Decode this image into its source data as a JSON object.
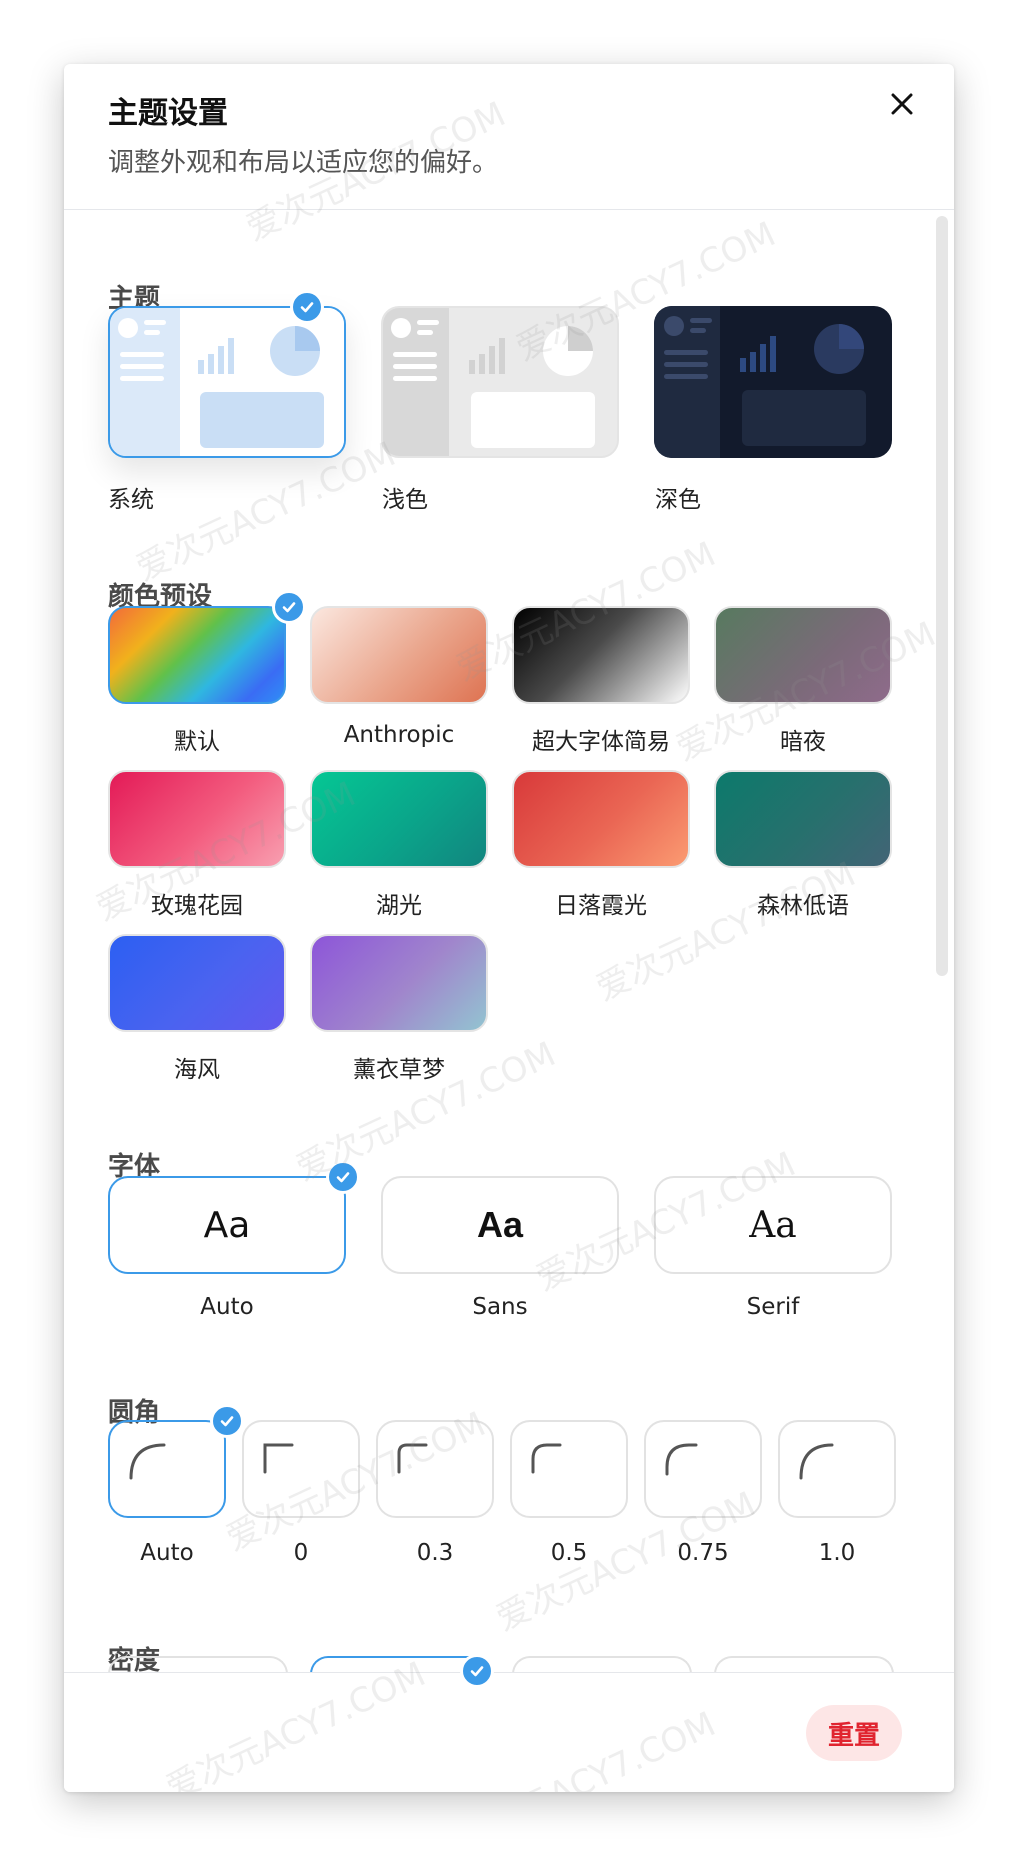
{
  "header": {
    "title": "主题设置",
    "subtitle": "调整外观和布局以适应您的偏好。",
    "close_icon": "close-icon"
  },
  "sections": {
    "theme": "主题",
    "color_presets": "颜色预设",
    "font": "字体",
    "radius": "圆角",
    "density": "密度"
  },
  "themes": [
    {
      "label": "系统",
      "selected": true
    },
    {
      "label": "浅色",
      "selected": false
    },
    {
      "label": "深色",
      "selected": false
    }
  ],
  "presets": [
    {
      "label": "默认",
      "selected": true,
      "gradient": "linear-gradient(135deg,#f26b3a 0%,#f1b11c 25%,#61c14a 45%,#2fb7e0 65%,#3a6cf4 85%,#2f8ef6 100%)"
    },
    {
      "label": "Anthropic",
      "selected": false,
      "gradient": "linear-gradient(135deg,#fbe7df 0%,#eaa68d 55%,#de7352 100%)"
    },
    {
      "label": "超大字体简易",
      "selected": false,
      "gradient": "linear-gradient(135deg,#000000 0%,#4a4a4a 45%,#ffffff 100%)"
    },
    {
      "label": "暗夜",
      "selected": false,
      "gradient": "linear-gradient(135deg,#577a5f 0%,#7b6a79 60%,#8f6b8b 100%)"
    },
    {
      "label": "玫瑰花园",
      "selected": false,
      "gradient": "linear-gradient(135deg,#e31a57 0%,#f35b7e 55%,#f89fb0 100%)"
    },
    {
      "label": "湖光",
      "selected": false,
      "gradient": "linear-gradient(135deg,#05c794 0%,#0aa58a 55%,#12857f 100%)"
    },
    {
      "label": "日落霞光",
      "selected": false,
      "gradient": "linear-gradient(135deg,#d8393a 0%,#ea6654 55%,#fb9b72 100%)"
    },
    {
      "label": "森林低语",
      "selected": false,
      "gradient": "linear-gradient(135deg,#0c7a6c 0%,#27706d 55%,#436476 100%)"
    },
    {
      "label": "海风",
      "selected": false,
      "gradient": "linear-gradient(135deg,#2c5ff2 0%,#4a63f0 55%,#6259ee 100%)"
    },
    {
      "label": "薰衣草梦",
      "selected": false,
      "gradient": "linear-gradient(135deg,#8d55d9 0%,#a086cc 55%,#93c4d1 100%)"
    }
  ],
  "fonts": [
    {
      "sample": "Aa",
      "label": "Auto",
      "selected": true
    },
    {
      "sample": "Aa",
      "label": "Sans",
      "selected": false
    },
    {
      "sample": "Aa",
      "label": "Serif",
      "selected": false
    }
  ],
  "radii": [
    {
      "label": "Auto",
      "selected": true
    },
    {
      "label": "0",
      "selected": false
    },
    {
      "label": "0.3",
      "selected": false
    },
    {
      "label": "0.5",
      "selected": false
    },
    {
      "label": "0.75",
      "selected": false
    },
    {
      "label": "1.0",
      "selected": false
    }
  ],
  "footer": {
    "reset_label": "重置"
  },
  "watermark": "爱次元ACY7.COM",
  "colors": {
    "accent": "#3b9ae8",
    "reset_text": "#e0242f",
    "reset_bg": "#fde6e6"
  }
}
